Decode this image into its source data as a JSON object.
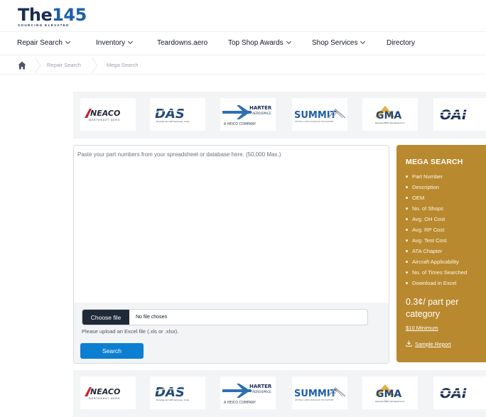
{
  "header": {
    "logo_the": "The",
    "logo_num": "145",
    "logo_tagline": "SOURCING ELEVATED"
  },
  "nav": {
    "items": [
      {
        "label": "Repair Search",
        "has_dropdown": true
      },
      {
        "label": "Inventory",
        "has_dropdown": true
      },
      {
        "label": "Teardowns.aero",
        "has_dropdown": false
      },
      {
        "label": "Top Shop Awards",
        "has_dropdown": true
      },
      {
        "label": "Shop Services",
        "has_dropdown": true
      },
      {
        "label": "Directory",
        "has_dropdown": false
      }
    ]
  },
  "breadcrumb": {
    "home_icon": "home-icon",
    "items": [
      "Repair Search",
      "Mega Search"
    ]
  },
  "sponsors": [
    {
      "name": "NEACO",
      "sub": "NORTHEAST AERO"
    },
    {
      "name": "DAS",
      "sub": "Diverse Aircraft Services, Corp."
    },
    {
      "name": "HARTER",
      "sub": "AEROSPACE",
      "tag": "A HEICO COMPANY"
    },
    {
      "name": "SUMMIT",
      "sub": "SETTING A NEW STANDARD FOR SUPPORT"
    },
    {
      "name": "GMA",
      "sub": "General MRO Aerospace Inc"
    },
    {
      "name": "OAI",
      "sub": ""
    }
  ],
  "form": {
    "placeholder": "Paste your part numbers from your spreadsheet or database here. (50,000 Max.)",
    "choose_file_label": "Choose file",
    "file_status": "No file chosen",
    "upload_help": "Please upload an Excel file (.xls or .xlsx).",
    "search_label": "Search"
  },
  "mega_search": {
    "title": "MEGA SEARCH",
    "features": [
      "Part Number",
      "Description",
      "OEM",
      "No. of Shops",
      "Avg. OH Cost",
      "Avg. RP Cost",
      "Avg. Test Cost",
      "ATA Chapter",
      "Aircraft Applicability",
      "No. of Times Searched",
      "Download in Excel"
    ],
    "price": "0.3¢/ part per category",
    "minimum": "$10 Minimum",
    "sample_label": "Sample Report",
    "sample_icon": "download-icon"
  },
  "colors": {
    "brand_navy": "#1a2d55",
    "brand_blue": "#1d5fab",
    "search_button": "#0d7fd1",
    "mega_panel": "#b9892f",
    "neaco_red": "#c8202f",
    "gma_gold": "#e0a020"
  }
}
